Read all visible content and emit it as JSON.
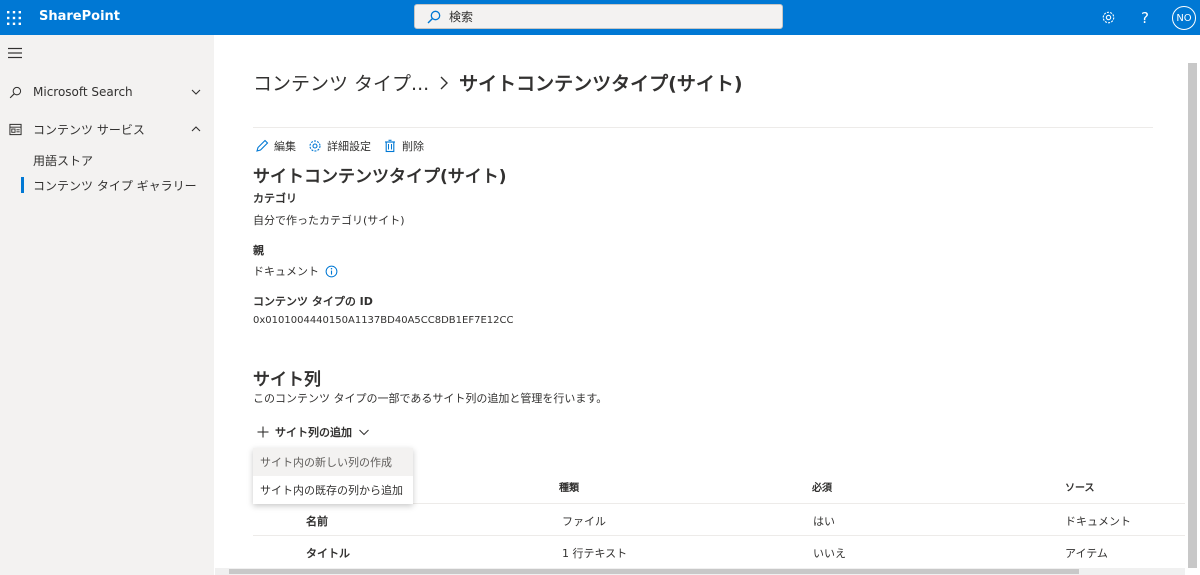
{
  "suitebar": {
    "brand": "SharePoint",
    "search_placeholder": "検索",
    "help": "?",
    "avatar": "NO",
    "accent": "#0078d4"
  },
  "leftnav": {
    "items": [
      {
        "label": "Microsoft Search",
        "icon": "search-icon",
        "expanded": false
      },
      {
        "label": "コンテンツ サービス",
        "icon": "content-services-icon",
        "expanded": true
      }
    ],
    "subitems": [
      {
        "label": "用語ストア",
        "active": false
      },
      {
        "label": "コンテンツ タイプ ギャラリー",
        "active": true
      }
    ]
  },
  "breadcrumb": {
    "parent": "コンテンツ タイプ...",
    "current": "サイトコンテンツタイプ(サイト)"
  },
  "commands": {
    "edit": "編集",
    "advanced": "詳細設定",
    "delete": "削除"
  },
  "content_type": {
    "title": "サイトコンテンツタイプ(サイト)",
    "category_label": "カテゴリ",
    "category_value": "自分で作ったカテゴリ(サイト)",
    "parent_label": "親",
    "parent_value": "ドキュメント",
    "id_label": "コンテンツ タイプの ID",
    "id_value": "0x0101004440150A1137BD40A5CC8DB1EF7E12CC"
  },
  "site_columns": {
    "title": "サイト列",
    "description": "このコンテンツ タイプの一部であるサイト列の追加と管理を行います。",
    "add_label": "サイト列の追加",
    "dropdown": [
      "サイト内の新しい列の作成",
      "サイト内の既存の列から追加"
    ],
    "headers": [
      "種類",
      "必須",
      "ソース"
    ],
    "rows": [
      {
        "name": "名前",
        "type": "ファイル",
        "required": "はい",
        "source": "ドキュメント"
      },
      {
        "name": "タイトル",
        "type": "1 行テキスト",
        "required": "いいえ",
        "source": "アイテム"
      }
    ]
  }
}
